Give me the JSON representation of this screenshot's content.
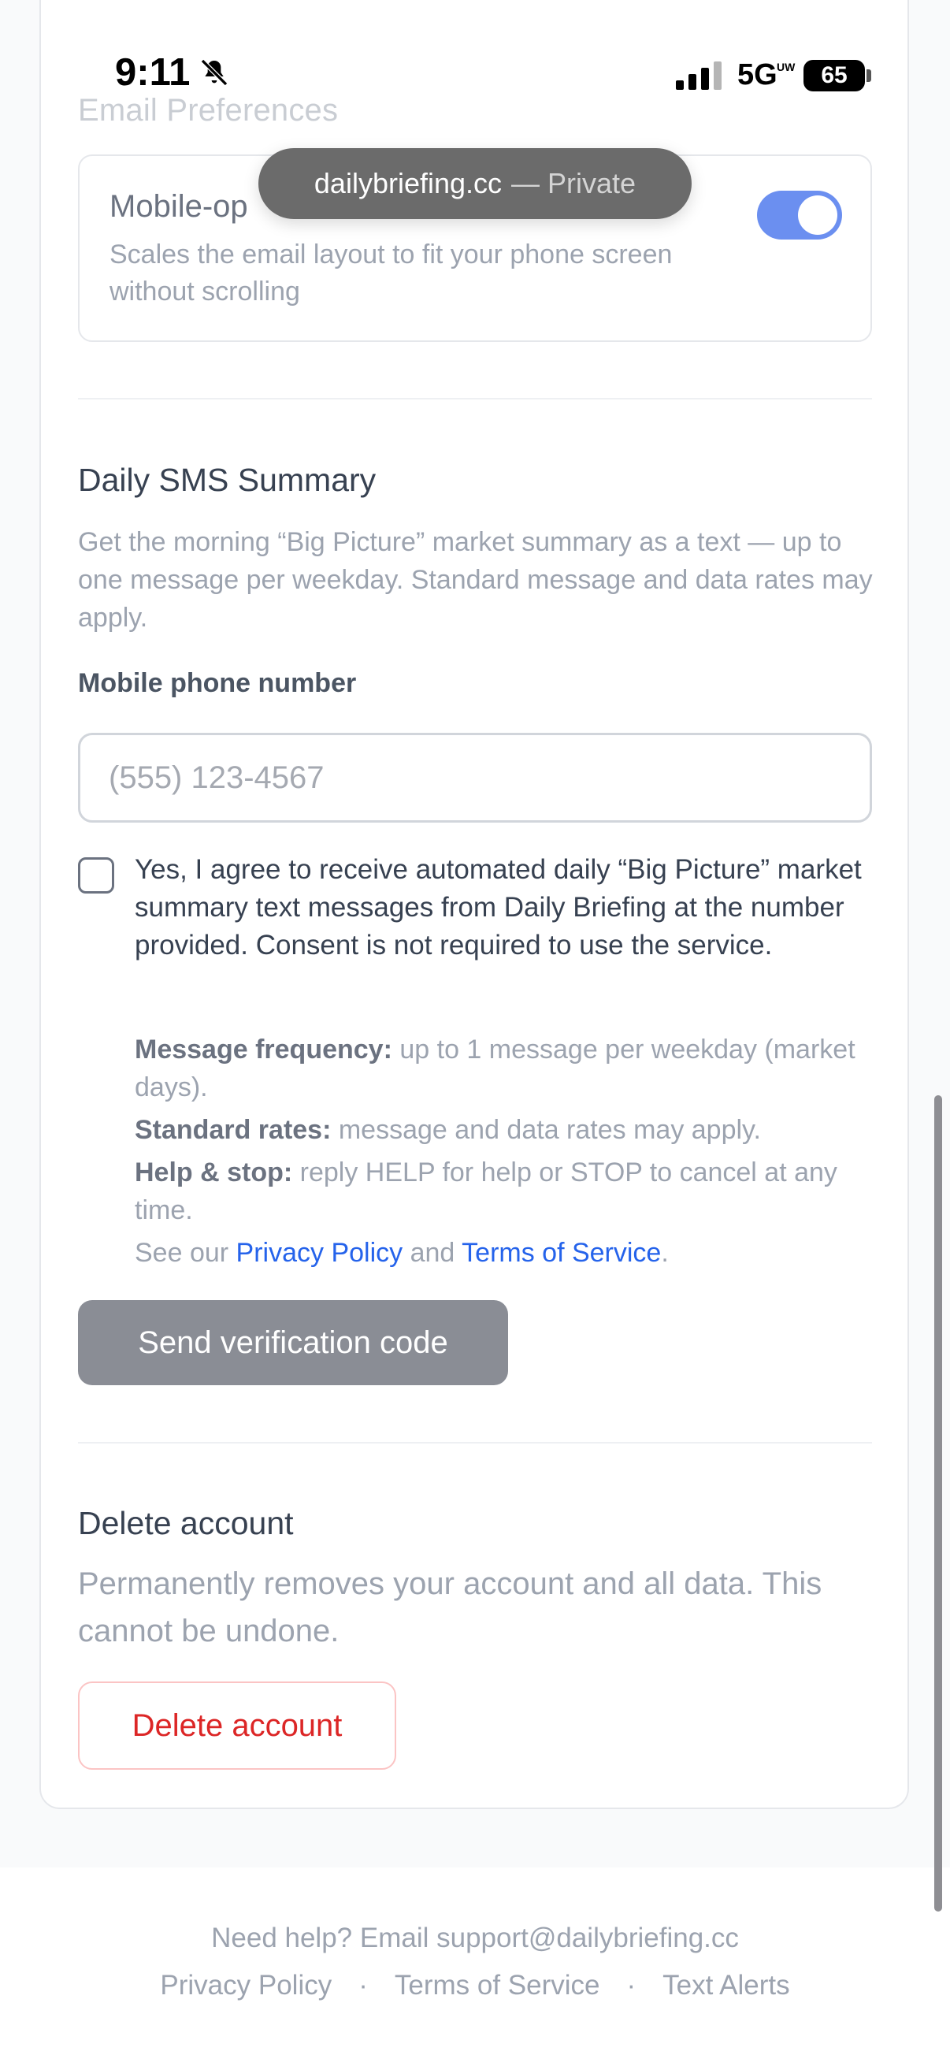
{
  "status_bar": {
    "time": "9:11",
    "network": "5G",
    "network_sub": "UW",
    "battery": "65"
  },
  "browser": {
    "domain": "dailybriefing.cc",
    "mode": "— Private"
  },
  "email_prefs": {
    "heading": "Email Preferences",
    "mobile_opt_title": "Mobile-op",
    "mobile_opt_desc": "Scales the email layout to fit your phone screen without scrolling",
    "toggle_on": true
  },
  "sms": {
    "heading": "Daily SMS Summary",
    "description": "Get the morning “Big Picture” market summary as a text — up to one message per weekday. Standard message and data rates may apply.",
    "phone_label": "Mobile phone number",
    "phone_placeholder": "(555) 123-4567",
    "consent_text": "Yes, I agree to receive automated daily “Big Picture” market summary text messages from Daily Briefing at the number provided. Consent is not required to use the service.",
    "freq_label": "Message frequency:",
    "freq_text": " up to 1 message per weekday (market days).",
    "rates_label": "Standard rates:",
    "rates_text": " message and data rates may apply.",
    "help_label": "Help & stop:",
    "help_text": " reply HELP for help or STOP to cancel at any time.",
    "see_our": "See our ",
    "privacy_link": "Privacy Policy",
    "and": " and ",
    "terms_link": "Terms of Service",
    "period": ".",
    "send_button": "Send verification code"
  },
  "delete": {
    "heading": "Delete account",
    "description": "Permanently removes your account and all data. This cannot be undone.",
    "button": "Delete account"
  },
  "footer": {
    "help_text": "Need help? Email support@dailybriefing.cc",
    "links": [
      "Privacy Policy",
      "Terms of Service",
      "Text Alerts"
    ],
    "separator": "·"
  }
}
